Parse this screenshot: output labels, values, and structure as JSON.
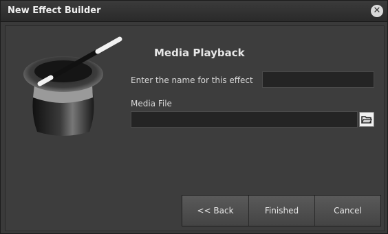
{
  "window": {
    "title": "New Effect Builder"
  },
  "heading": "Media Playback",
  "name_field": {
    "label": "Enter the name for this effect",
    "value": ""
  },
  "media_field": {
    "label": "Media File",
    "value": ""
  },
  "buttons": {
    "back": "<< Back",
    "finished": "Finished",
    "cancel": "Cancel"
  }
}
